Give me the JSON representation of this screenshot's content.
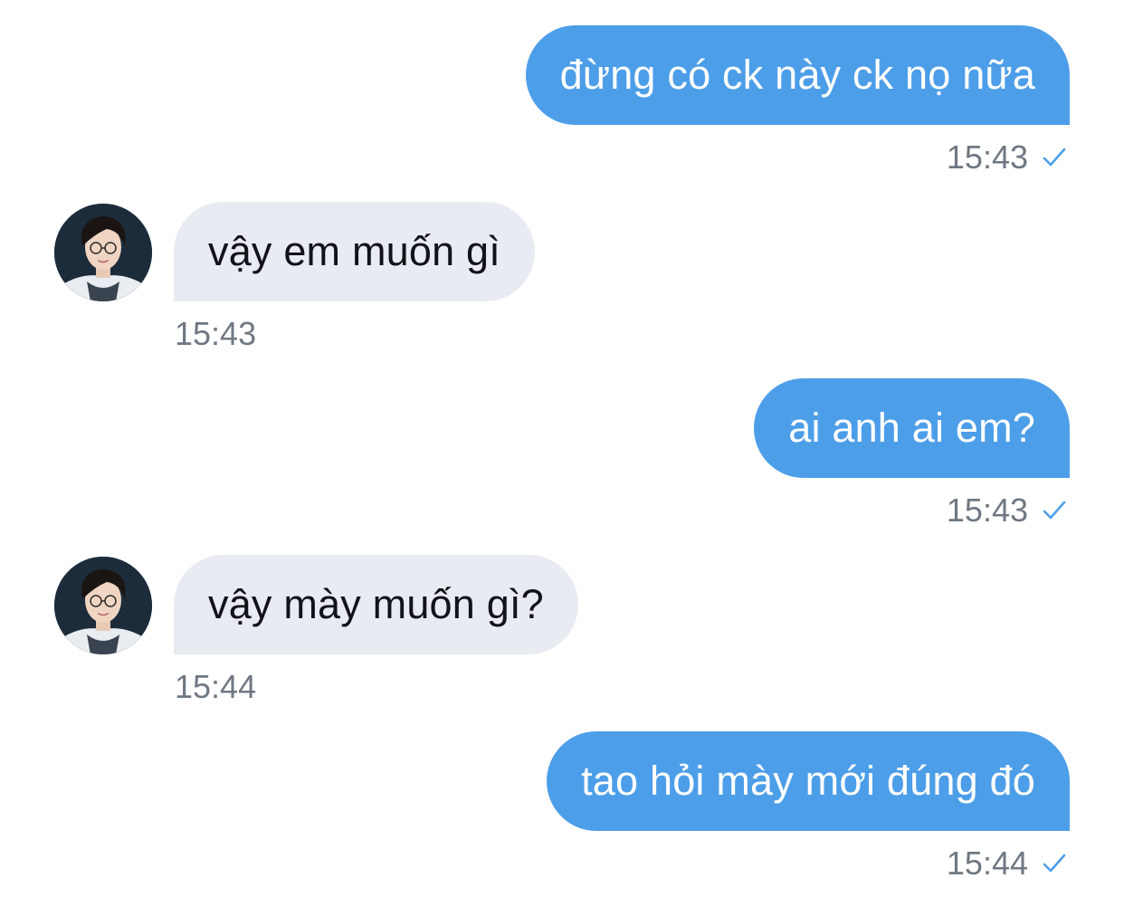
{
  "messages": [
    {
      "direction": "out",
      "text": "đừng có ck này ck nọ nữa",
      "time": "15:43",
      "status_icon": "check-icon"
    },
    {
      "direction": "in",
      "text": "vậy em muốn gì",
      "time": "15:43",
      "avatar_icon": "contact-avatar"
    },
    {
      "direction": "out",
      "text": "ai anh ai em?",
      "time": "15:43",
      "status_icon": "check-icon"
    },
    {
      "direction": "in",
      "text": "vậy mày muốn gì?",
      "time": "15:44",
      "avatar_icon": "contact-avatar"
    },
    {
      "direction": "out",
      "text": "tao hỏi mày mới đúng đó",
      "time": "15:44",
      "status_icon": "check-icon"
    }
  ],
  "colors": {
    "outgoing_bubble": "#4d9ee9",
    "incoming_bubble": "#e8ebf1",
    "timestamp": "#6f7883",
    "check": "#4d9ee9"
  }
}
